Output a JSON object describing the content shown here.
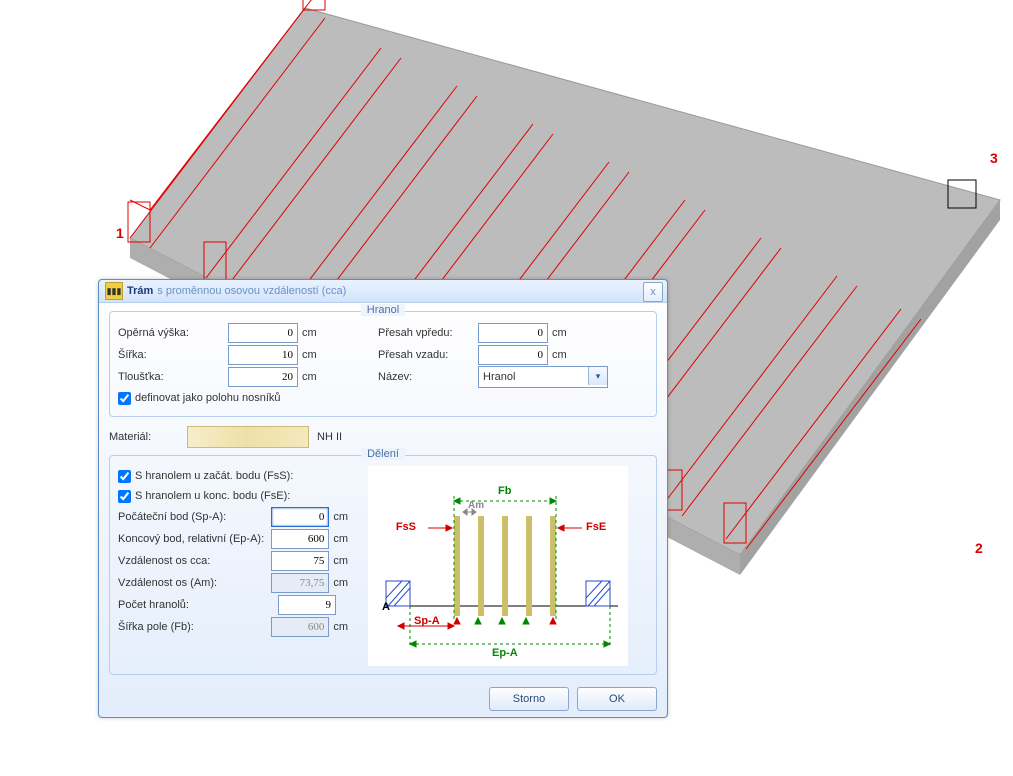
{
  "viewport": {
    "point_labels": [
      "1",
      "2",
      "3"
    ]
  },
  "dialog": {
    "title_strong": "Trám",
    "title_rest": "s proměnnou osovou vzdáleností (cca)",
    "close": "x",
    "group_hranol": {
      "legend": "Hranol",
      "left": {
        "operna_vyska_label": "Opěrná výška:",
        "operna_vyska_value": "0",
        "sirka_label": "Šířka:",
        "sirka_value": "10",
        "tloustka_label": "Tloušťka:",
        "tloustka_value": "20"
      },
      "right": {
        "presah_vpredu_label": "Přesah vpředu:",
        "presah_vpredu_value": "0",
        "presah_vzadu_label": "Přesah vzadu:",
        "presah_vzadu_value": "0",
        "nazev_label": "Název:",
        "nazev_value": "Hranol"
      },
      "unit": "cm",
      "checkbox_label": "definovat jako polohu nosníků"
    },
    "material": {
      "label": "Materiál:",
      "name": "NH II"
    },
    "group_deleni": {
      "legend": "Dělení",
      "chk_fss": "S hranolem u začát. bodu (FsS):",
      "chk_fse": "S hranolem u konc. bodu (FsE):",
      "rows": {
        "spa_label": "Počáteční bod  (Sp-A):",
        "spa_value": "0",
        "epa_label": "Koncový bod, relativní  (Ep-A):",
        "epa_value": "600",
        "vzd_cca_label": "Vzdálenost os cca:",
        "vzd_cca_value": "75",
        "am_label": "Vzdálenost os (Am):",
        "am_value": "73,75",
        "pocet_label": "Počet hranolů:",
        "pocet_value": "9",
        "fb_label": "Šířka pole (Fb):",
        "fb_value": "600"
      },
      "unit": "cm",
      "diagram": {
        "Fb": "Fb",
        "Am": "Am",
        "FsS": "FsS",
        "FsE": "FsE",
        "A": "A",
        "SpA": "Sp-A",
        "EpA": "Ep-A"
      }
    },
    "buttons": {
      "storno": "Storno",
      "ok": "OK"
    }
  }
}
